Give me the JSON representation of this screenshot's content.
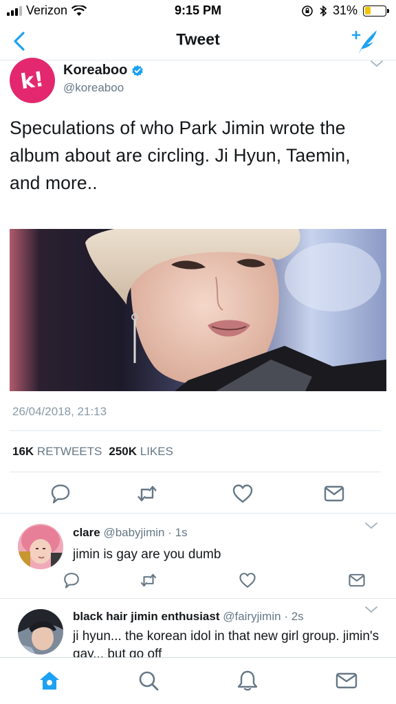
{
  "status_bar": {
    "carrier": "Verizon",
    "time": "9:15 PM",
    "battery_percent": "31%",
    "battery_level": 0.31
  },
  "nav": {
    "title": "Tweet"
  },
  "tweet": {
    "author_name": "Koreaboo",
    "author_handle": "@koreaboo",
    "avatar_letter": "k!",
    "text": "Speculations of who Park Jimin wrote the album about are circling. Ji Hyun, Taemin, and more..",
    "timestamp": "26/04/2018, 21:13",
    "retweets_count": "16K",
    "retweets_label": "RETWEETS",
    "likes_count": "250K",
    "likes_label": "LIKES"
  },
  "replies": [
    {
      "name": "clare",
      "handle": "@babyjimin",
      "time": "1s",
      "text": "jimin is gay are you dumb"
    },
    {
      "name": "black hair jimin enthusiast",
      "handle": "@fairyjimin",
      "time": "2s",
      "text": "ji hyun... the korean idol in that new girl group. jimin's gay... but go off"
    }
  ],
  "colors": {
    "accent": "#1da1f2",
    "brand_pink": "#e3286f",
    "muted": "#657786"
  },
  "icons": [
    "back-chevron-icon",
    "compose-sparkle-icon",
    "verified-icon",
    "reply-icon",
    "retweet-icon",
    "like-icon",
    "dm-icon",
    "home-icon",
    "search-icon",
    "notifications-icon",
    "messages-icon"
  ]
}
